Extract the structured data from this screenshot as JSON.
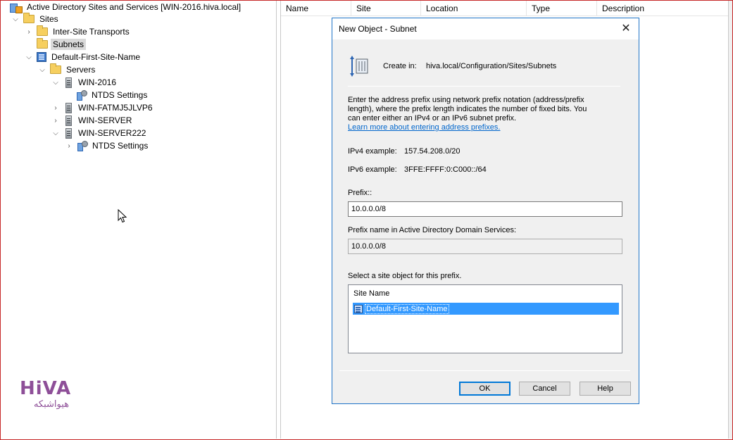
{
  "tree": {
    "root": "Active Directory Sites and Services [WIN-2016.hiva.local]",
    "items": [
      {
        "label": "Sites",
        "expanded": true
      },
      {
        "label": "Inter-Site Transports",
        "expanded": false
      },
      {
        "label": "Subnets",
        "selected": true
      },
      {
        "label": "Default-First-Site-Name",
        "expanded": true
      },
      {
        "label": "Servers",
        "expanded": true
      },
      {
        "label": "WIN-2016",
        "expanded": true
      },
      {
        "label": "NTDS Settings"
      },
      {
        "label": "WIN-FATMJ5JLVP6",
        "expanded": false
      },
      {
        "label": "WIN-SERVER",
        "expanded": false
      },
      {
        "label": "WIN-SERVER222",
        "expanded": true
      },
      {
        "label": "NTDS Settings",
        "expanded": false
      }
    ]
  },
  "list": {
    "columns": [
      "Name",
      "Site",
      "Location",
      "Type",
      "Description"
    ]
  },
  "dialog": {
    "title": "New Object - Subnet",
    "close_glyph": "✕",
    "create_in_label": "Create in:",
    "create_in_value": "hiva.local/Configuration/Sites/Subnets",
    "description": "Enter the address prefix using network prefix notation (address/prefix length), where the prefix length indicates the number of fixed bits. You can enter either an IPv4 or an IPv6 subnet prefix.",
    "learn_more_link": "Learn more about entering address prefixes.",
    "ipv4_label": "IPv4 example:",
    "ipv4_value": "157.54.208.0/20",
    "ipv6_label": "IPv6 example:",
    "ipv6_value": "3FFE:FFFF:0:C000::/64",
    "prefix_label": "Prefix::",
    "prefix_value": "10.0.0.0/8",
    "prefix_name_label": "Prefix name in Active Directory Domain Services:",
    "prefix_name_value": "10.0.0.0/8",
    "site_select_label": "Select a site object for this prefix.",
    "site_list_header": "Site Name",
    "site_list_items": [
      "Default-First-Site-Name"
    ],
    "buttons": {
      "ok": "OK",
      "cancel": "Cancel",
      "help": "Help"
    }
  },
  "logo": {
    "latin": "HiVA",
    "persian": "هیواشبکه"
  },
  "colors": {
    "dialog_border": "#1e73c7",
    "selection": "#3399ff",
    "link": "#0066cc",
    "logo": "#8e4f98",
    "frame": "#c62828"
  }
}
